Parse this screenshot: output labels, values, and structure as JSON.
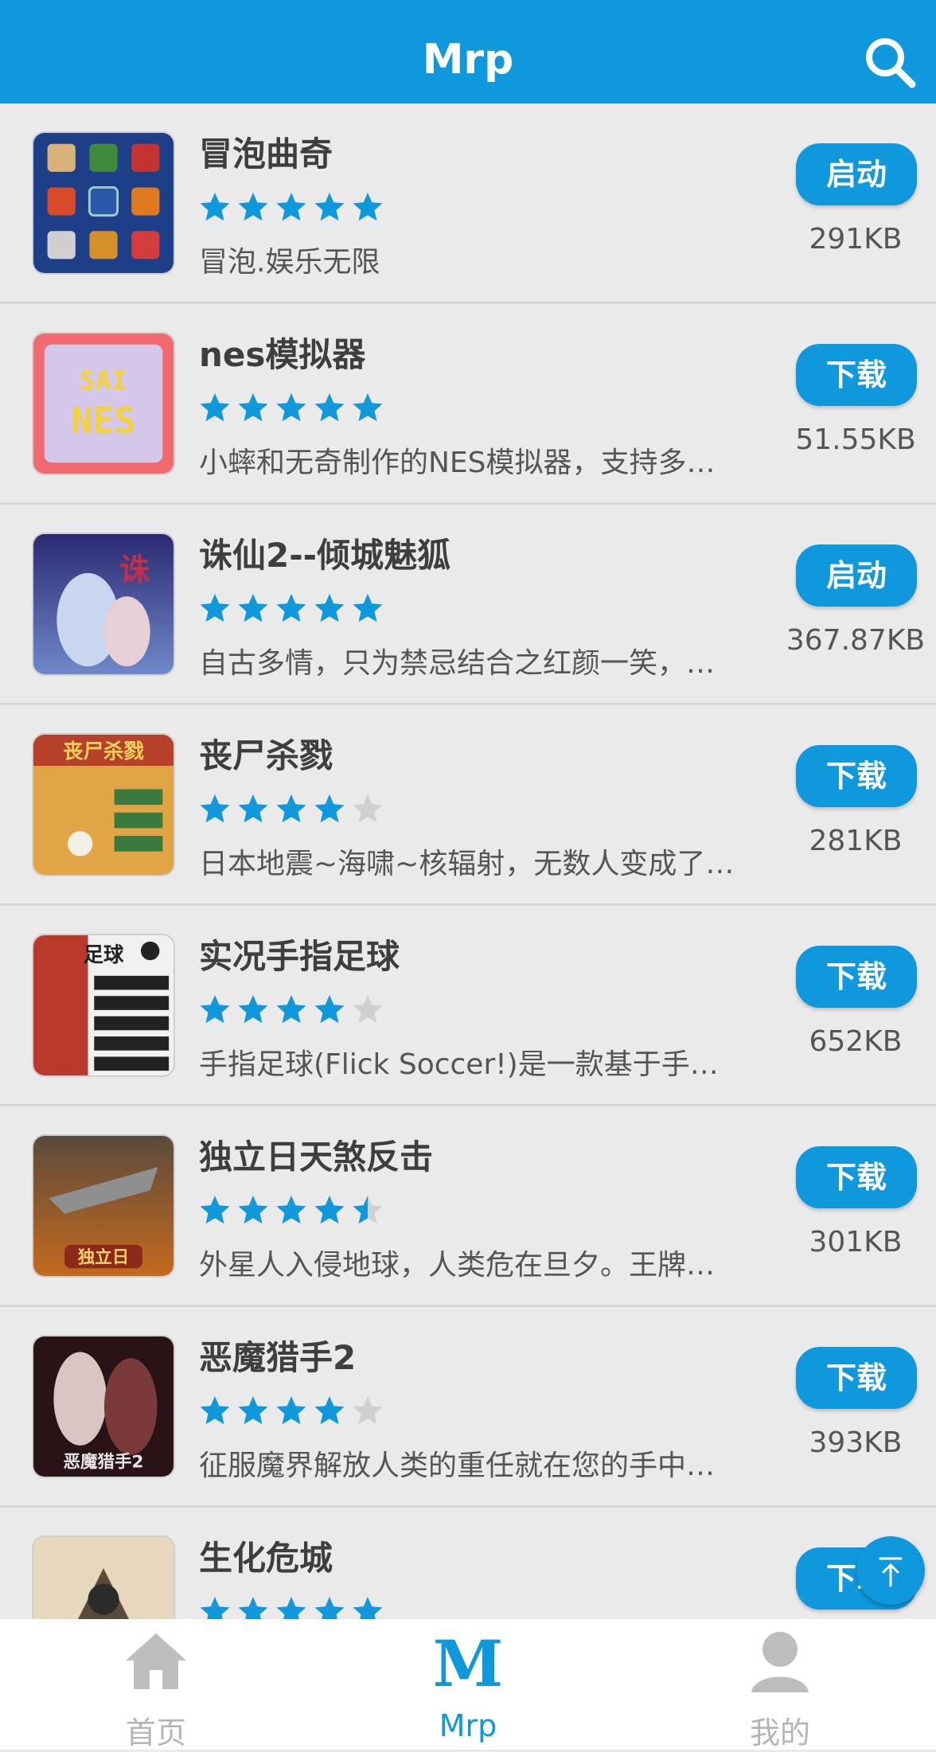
{
  "header": {
    "title": "Mrp",
    "search_icon": "search-icon"
  },
  "colors": {
    "primary": "#0f98dc",
    "star_on": "#0f98dc",
    "star_off": "#d0d0d0"
  },
  "apps": [
    {
      "name": "冒泡曲奇",
      "rating": 5,
      "description": "冒泡.娱乐无限",
      "action": "启动",
      "size": "291KB"
    },
    {
      "name": " nes模拟器",
      "rating": 5,
      "description": "小蟀和无奇制作的NES模拟器，支持多…",
      "action": "下载",
      "size": "51.55KB"
    },
    {
      "name": "诛仙2--倾城魅狐",
      "rating": 5,
      "description": "自古多情，只为禁忌结合之红颜一笑，…",
      "action": "启动",
      "size": "367.87KB"
    },
    {
      "name": "丧尸杀戮",
      "rating": 4,
      "description": "日本地震~海啸~核辐射，无数人变成了…",
      "action": "下载",
      "size": "281KB"
    },
    {
      "name": "实况手指足球",
      "rating": 4,
      "description": "手指足球(Flick Soccer!)是一款基于手…",
      "action": "下载",
      "size": "652KB"
    },
    {
      "name": "独立日天煞反击",
      "rating": 4.5,
      "description": "外星人入侵地球，人类危在旦夕。王牌…",
      "action": "下载",
      "size": "301KB"
    },
    {
      "name": "恶魔猎手2",
      "rating": 4,
      "description": "征服魔界解放人类的重任就在您的手中…",
      "action": "下载",
      "size": "393KB"
    },
    {
      "name": "生化危城",
      "rating": 5,
      "description": "",
      "action": "下载",
      "size": ""
    }
  ],
  "fab": {
    "icon": "arrow-up-icon"
  },
  "bottom_nav": [
    {
      "label": "首页",
      "icon": "home-icon",
      "active": false
    },
    {
      "label": "Mrp",
      "icon": "mrp-logo-icon",
      "active": true
    },
    {
      "label": "我的",
      "icon": "user-icon",
      "active": false
    }
  ]
}
